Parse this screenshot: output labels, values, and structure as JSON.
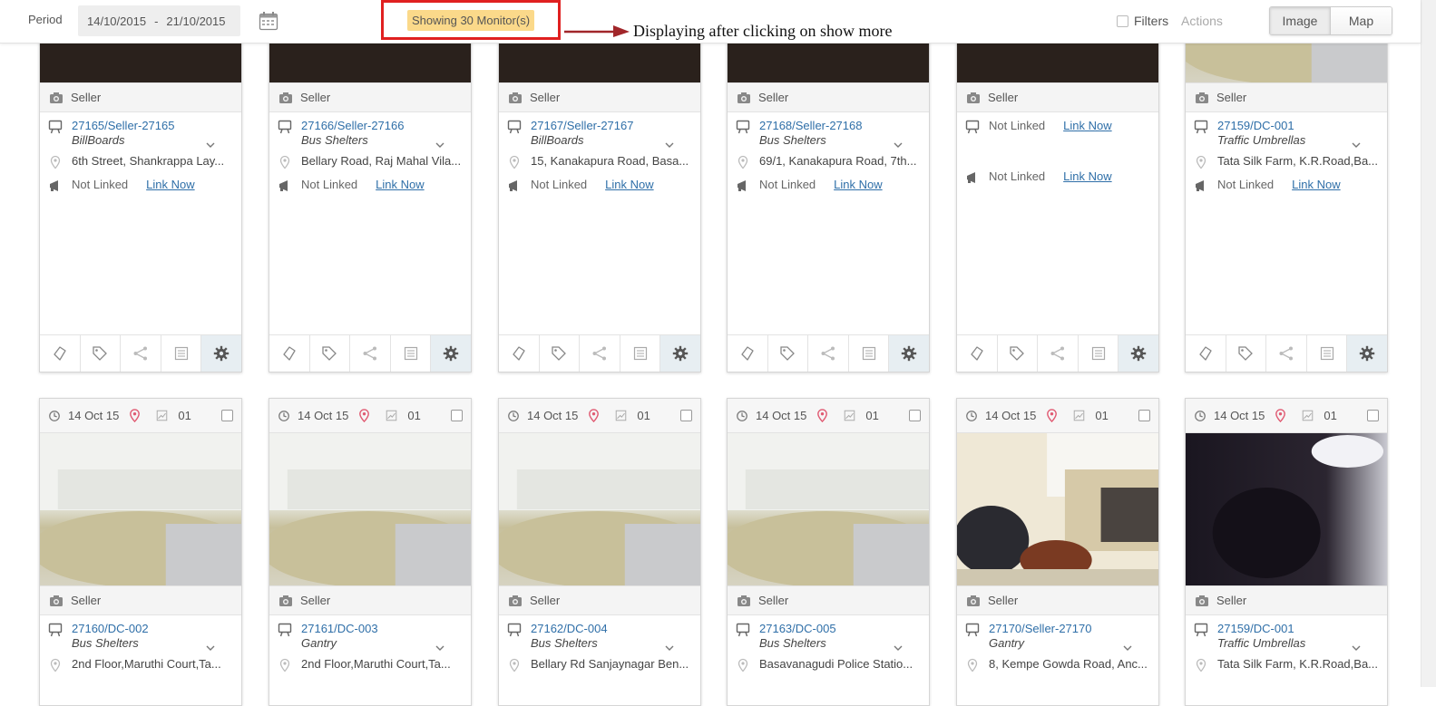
{
  "header": {
    "period_label": "Period",
    "date_from": "14/10/2015",
    "date_sep": "-",
    "date_to": "21/10/2015",
    "showing": "Showing 30 Monitor(s)",
    "annotation": "Displaying after clicking on show more",
    "filters_label": "Filters",
    "actions_label": "Actions",
    "view_image": "Image",
    "view_map": "Map"
  },
  "row1": [
    {
      "seller": "Seller",
      "code": "27165/Seller-27165",
      "category": "BillBoards",
      "address": "6th Street, Shankrappa Lay...",
      "link_status": "Not Linked",
      "link_now": "Link Now"
    },
    {
      "seller": "Seller",
      "code": "27166/Seller-27166",
      "category": "Bus Shelters",
      "address": "Bellary Road, Raj Mahal Vila...",
      "link_status": "Not Linked",
      "link_now": "Link Now"
    },
    {
      "seller": "Seller",
      "code": "27167/Seller-27167",
      "category": "BillBoards",
      "address": "15, Kanakapura Road, Basa...",
      "link_status": "Not Linked",
      "link_now": "Link Now"
    },
    {
      "seller": "Seller",
      "code": "27168/Seller-27168",
      "category": "Bus Shelters",
      "address": "69/1, Kanakapura Road, 7th...",
      "link_status": "Not Linked",
      "link_now": "Link Now"
    },
    {
      "seller": "Seller",
      "top_status": "Not Linked",
      "top_link": "Link Now",
      "link_status": "Not Linked",
      "link_now": "Link Now"
    },
    {
      "seller": "Seller",
      "code": "27159/DC-001",
      "category": "Traffic Umbrellas",
      "address": "Tata Silk Farm, K.R.Road,Ba...",
      "link_status": "Not Linked",
      "link_now": "Link Now"
    }
  ],
  "row2": [
    {
      "date": "14 Oct 15",
      "count": "01",
      "seller": "Seller",
      "code": "27160/DC-002",
      "category": "Bus Shelters",
      "address": "2nd Floor,Maruthi Court,Ta..."
    },
    {
      "date": "14 Oct 15",
      "count": "01",
      "seller": "Seller",
      "code": "27161/DC-003",
      "category": "Gantry",
      "address": "2nd Floor,Maruthi Court,Ta..."
    },
    {
      "date": "14 Oct 15",
      "count": "01",
      "seller": "Seller",
      "code": "27162/DC-004",
      "category": "Bus Shelters",
      "address": "Bellary Rd Sanjaynagar Ben..."
    },
    {
      "date": "14 Oct 15",
      "count": "01",
      "seller": "Seller",
      "code": "27163/DC-005",
      "category": "Bus Shelters",
      "address": "Basavanagudi Police Statio..."
    },
    {
      "date": "14 Oct 15",
      "count": "01",
      "seller": "Seller",
      "code": "27170/Seller-27170",
      "category": "Gantry",
      "address": "8, Kempe Gowda Road, Anc..."
    },
    {
      "date": "14 Oct 15",
      "count": "01",
      "seller": "Seller",
      "code": "27159/DC-001",
      "category": "Traffic Umbrellas",
      "address": "Tata Silk Farm, K.R.Road,Ba..."
    }
  ]
}
